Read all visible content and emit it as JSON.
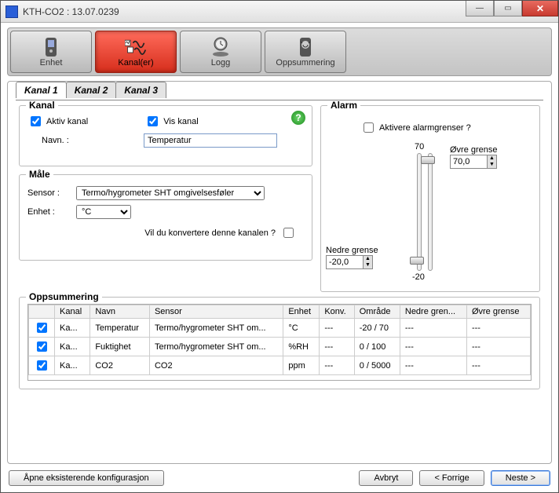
{
  "window": {
    "title": "KTH-CO2 : 13.07.0239"
  },
  "toolbar": {
    "items": [
      {
        "label": "Enhet"
      },
      {
        "label": "Kanal(er)"
      },
      {
        "label": "Logg"
      },
      {
        "label": "Oppsummering"
      }
    ]
  },
  "tabs": {
    "items": [
      "Kanal 1",
      "Kanal 2",
      "Kanal 3"
    ]
  },
  "kanal": {
    "legend": "Kanal",
    "aktiv_label": "Aktiv kanal",
    "vis_label": "Vis kanal",
    "navn_label": "Navn. :",
    "navn_value": "Temperatur"
  },
  "maale": {
    "legend": "Måle",
    "sensor_label": "Sensor :",
    "sensor_value": "Termo/hygrometer SHT omgivelsesføler",
    "enhet_label": "Enhet :",
    "enhet_value": "°C",
    "convert_label": "Vil du konvertere denne kanalen ?"
  },
  "alarm": {
    "legend": "Alarm",
    "activate_label": "Aktivere alarmgrenser ?",
    "upper_tick": "70",
    "lower_tick": "-20",
    "upper_label": "Øvre grense",
    "upper_value": "70,0",
    "lower_label": "Nedre grense",
    "lower_value": "-20,0"
  },
  "summary": {
    "legend": "Oppsummering",
    "headers": [
      "Kanal",
      "Navn",
      "Sensor",
      "Enhet",
      "Konv.",
      "Område",
      "Nedre gren...",
      "Øvre grense"
    ],
    "rows": [
      {
        "kanal": "Ka...",
        "navn": "Temperatur",
        "sensor": "Termo/hygrometer SHT om...",
        "enhet": "°C",
        "konv": "---",
        "omrade": "-20 / 70",
        "nedre": "---",
        "ovre": "---"
      },
      {
        "kanal": "Ka...",
        "navn": "Fuktighet",
        "sensor": "Termo/hygrometer SHT om...",
        "enhet": "%RH",
        "konv": "---",
        "omrade": "0 / 100",
        "nedre": "---",
        "ovre": "---"
      },
      {
        "kanal": "Ka...",
        "navn": "CO2",
        "sensor": "CO2",
        "enhet": "ppm",
        "konv": "---",
        "omrade": "0 / 5000",
        "nedre": "---",
        "ovre": "---"
      }
    ]
  },
  "footer": {
    "open": "Åpne eksisterende konfigurasjon",
    "cancel": "Avbryt",
    "back": "< Forrige",
    "next": "Neste >"
  }
}
